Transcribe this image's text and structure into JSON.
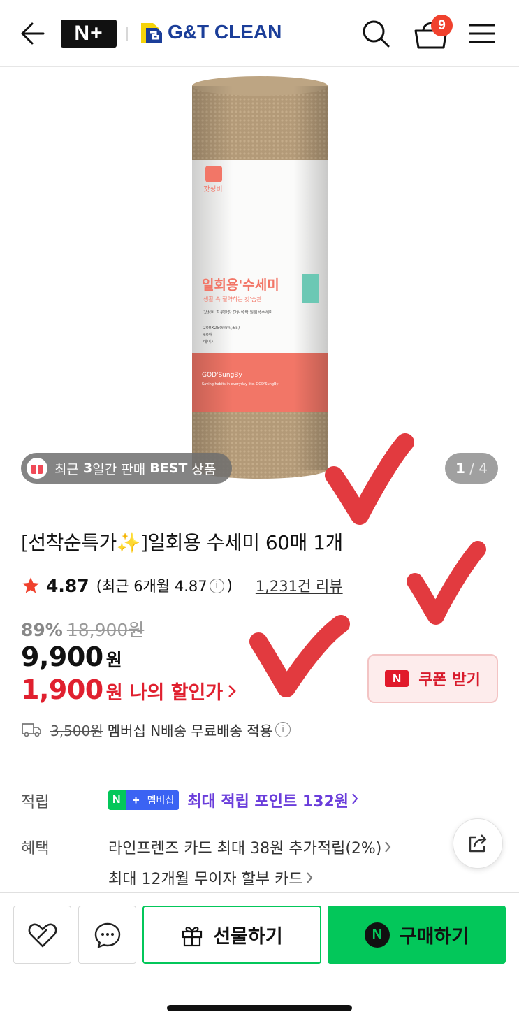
{
  "header": {
    "platform_logo": "N+",
    "brand_name": "G&T CLEAN",
    "cart_count": "9",
    "icons": [
      "back-arrow-icon",
      "search-icon",
      "cart-icon",
      "menu-icon"
    ]
  },
  "gallery": {
    "best_badge": {
      "prefix": "최근 ",
      "days": "3",
      "middle": "일간 판매 ",
      "best": "BEST",
      "suffix": " 상품"
    },
    "page_current": "1",
    "page_separator": " / ",
    "page_total": "4",
    "product_label": {
      "brand": "갓성비",
      "name": "일회용'수세미",
      "tagline": "생활 속 절약하는 갓'습관",
      "desc": "갓성비 하루한장 안심쓱싹 일회용수세미",
      "spec1": "200X250mm(±5)",
      "spec2": "60매",
      "spec3": "베이지",
      "band_title": "GOD'SungBy",
      "band_sub": "Saving habits in everyday life, GOD'SungBy"
    }
  },
  "product": {
    "title": "[선착순특가✨]일회용 수세미 60매 1개",
    "rating": "4.87",
    "rating_recent_prefix": "(최근 6개월 4.87",
    "rating_recent_suffix": ")",
    "review_count": "1,231건 리뷰",
    "discount_rate": "89%",
    "original_price": "18,900원",
    "sale_price": "9,900",
    "sale_price_unit": "원",
    "my_price": "1,900",
    "my_price_unit": "원",
    "my_price_label": "나의 할인가",
    "coupon_label": "쿠폰 받기",
    "delivery_original": "3,500원",
    "delivery_text": "멤버십 N배송 무료배송 적용"
  },
  "benefits": {
    "point_label": "적립",
    "membership_badge": "멤버십",
    "point_text": "최대 적립 포인트 ",
    "point_amount": "132원",
    "benefit_label": "혜택",
    "benefit_line1": "라인프렌즈 카드 최대 38원 추가적립(2%)",
    "benefit_line2": "최대 12개월 무이자 할부 카드"
  },
  "bottom_bar": {
    "gift_label": "선물하기",
    "buy_label": "구매하기"
  },
  "colors": {
    "naver_green": "#03c75a",
    "price_red": "#e0202f",
    "point_purple": "#6a3ddb",
    "brand_blue": "#1b3e99",
    "check_red": "#e23a3f"
  }
}
